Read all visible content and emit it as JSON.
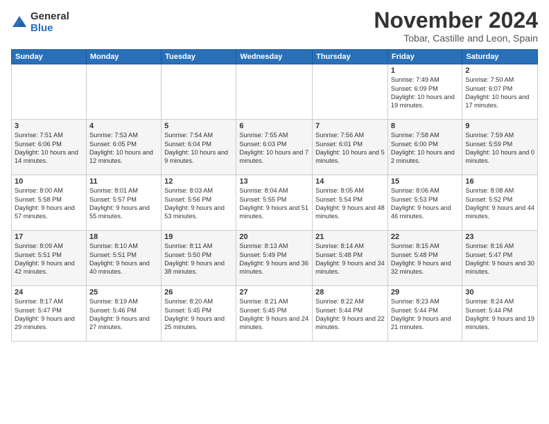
{
  "logo": {
    "general": "General",
    "blue": "Blue"
  },
  "title": "November 2024",
  "subtitle": "Tobar, Castille and Leon, Spain",
  "days_header": [
    "Sunday",
    "Monday",
    "Tuesday",
    "Wednesday",
    "Thursday",
    "Friday",
    "Saturday"
  ],
  "weeks": [
    [
      {
        "day": "",
        "info": ""
      },
      {
        "day": "",
        "info": ""
      },
      {
        "day": "",
        "info": ""
      },
      {
        "day": "",
        "info": ""
      },
      {
        "day": "",
        "info": ""
      },
      {
        "day": "1",
        "info": "Sunrise: 7:49 AM\nSunset: 6:09 PM\nDaylight: 10 hours and 19 minutes."
      },
      {
        "day": "2",
        "info": "Sunrise: 7:50 AM\nSunset: 6:07 PM\nDaylight: 10 hours and 17 minutes."
      }
    ],
    [
      {
        "day": "3",
        "info": "Sunrise: 7:51 AM\nSunset: 6:06 PM\nDaylight: 10 hours and 14 minutes."
      },
      {
        "day": "4",
        "info": "Sunrise: 7:53 AM\nSunset: 6:05 PM\nDaylight: 10 hours and 12 minutes."
      },
      {
        "day": "5",
        "info": "Sunrise: 7:54 AM\nSunset: 6:04 PM\nDaylight: 10 hours and 9 minutes."
      },
      {
        "day": "6",
        "info": "Sunrise: 7:55 AM\nSunset: 6:03 PM\nDaylight: 10 hours and 7 minutes."
      },
      {
        "day": "7",
        "info": "Sunrise: 7:56 AM\nSunset: 6:01 PM\nDaylight: 10 hours and 5 minutes."
      },
      {
        "day": "8",
        "info": "Sunrise: 7:58 AM\nSunset: 6:00 PM\nDaylight: 10 hours and 2 minutes."
      },
      {
        "day": "9",
        "info": "Sunrise: 7:59 AM\nSunset: 5:59 PM\nDaylight: 10 hours and 0 minutes."
      }
    ],
    [
      {
        "day": "10",
        "info": "Sunrise: 8:00 AM\nSunset: 5:58 PM\nDaylight: 9 hours and 57 minutes."
      },
      {
        "day": "11",
        "info": "Sunrise: 8:01 AM\nSunset: 5:57 PM\nDaylight: 9 hours and 55 minutes."
      },
      {
        "day": "12",
        "info": "Sunrise: 8:03 AM\nSunset: 5:56 PM\nDaylight: 9 hours and 53 minutes."
      },
      {
        "day": "13",
        "info": "Sunrise: 8:04 AM\nSunset: 5:55 PM\nDaylight: 9 hours and 51 minutes."
      },
      {
        "day": "14",
        "info": "Sunrise: 8:05 AM\nSunset: 5:54 PM\nDaylight: 9 hours and 48 minutes."
      },
      {
        "day": "15",
        "info": "Sunrise: 8:06 AM\nSunset: 5:53 PM\nDaylight: 9 hours and 46 minutes."
      },
      {
        "day": "16",
        "info": "Sunrise: 8:08 AM\nSunset: 5:52 PM\nDaylight: 9 hours and 44 minutes."
      }
    ],
    [
      {
        "day": "17",
        "info": "Sunrise: 8:09 AM\nSunset: 5:51 PM\nDaylight: 9 hours and 42 minutes."
      },
      {
        "day": "18",
        "info": "Sunrise: 8:10 AM\nSunset: 5:51 PM\nDaylight: 9 hours and 40 minutes."
      },
      {
        "day": "19",
        "info": "Sunrise: 8:11 AM\nSunset: 5:50 PM\nDaylight: 9 hours and 38 minutes."
      },
      {
        "day": "20",
        "info": "Sunrise: 8:13 AM\nSunset: 5:49 PM\nDaylight: 9 hours and 36 minutes."
      },
      {
        "day": "21",
        "info": "Sunrise: 8:14 AM\nSunset: 5:48 PM\nDaylight: 9 hours and 34 minutes."
      },
      {
        "day": "22",
        "info": "Sunrise: 8:15 AM\nSunset: 5:48 PM\nDaylight: 9 hours and 32 minutes."
      },
      {
        "day": "23",
        "info": "Sunrise: 8:16 AM\nSunset: 5:47 PM\nDaylight: 9 hours and 30 minutes."
      }
    ],
    [
      {
        "day": "24",
        "info": "Sunrise: 8:17 AM\nSunset: 5:47 PM\nDaylight: 9 hours and 29 minutes."
      },
      {
        "day": "25",
        "info": "Sunrise: 8:19 AM\nSunset: 5:46 PM\nDaylight: 9 hours and 27 minutes."
      },
      {
        "day": "26",
        "info": "Sunrise: 8:20 AM\nSunset: 5:45 PM\nDaylight: 9 hours and 25 minutes."
      },
      {
        "day": "27",
        "info": "Sunrise: 8:21 AM\nSunset: 5:45 PM\nDaylight: 9 hours and 24 minutes."
      },
      {
        "day": "28",
        "info": "Sunrise: 8:22 AM\nSunset: 5:44 PM\nDaylight: 9 hours and 22 minutes."
      },
      {
        "day": "29",
        "info": "Sunrise: 8:23 AM\nSunset: 5:44 PM\nDaylight: 9 hours and 21 minutes."
      },
      {
        "day": "30",
        "info": "Sunrise: 8:24 AM\nSunset: 5:44 PM\nDaylight: 9 hours and 19 minutes."
      }
    ]
  ]
}
